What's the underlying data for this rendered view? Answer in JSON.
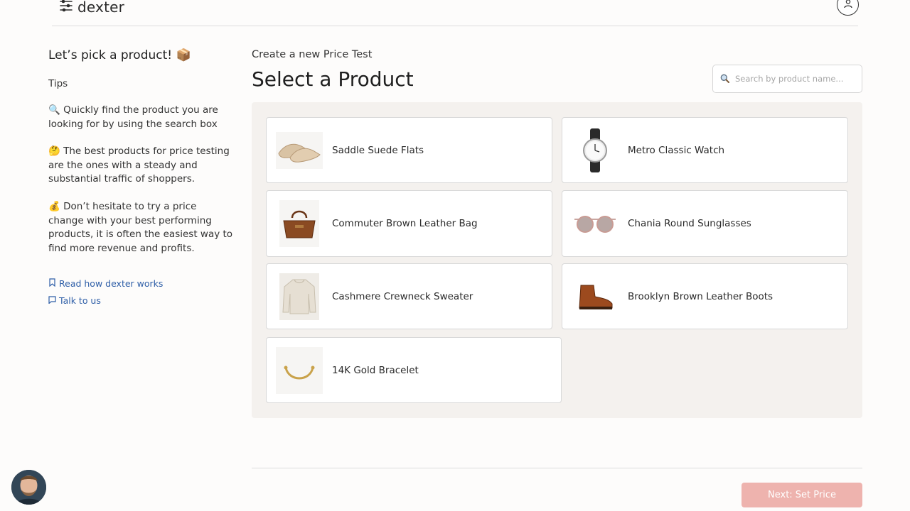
{
  "header": {
    "logo_text": "dexter",
    "logo_icon": "sliders-icon",
    "account_icon": "user-icon"
  },
  "sidebar": {
    "title": "Let’s pick a product! 📦",
    "tips_heading": "Tips",
    "tips": [
      "🔍 Quickly find the product you are looking for by using the search box",
      "🤔 The best products for price testing are the ones with a steady and substantial traffic of shoppers.",
      "💰 Don’t hesitate to try a price change with your best performing products, it is often the easiest way to find more revenue and profits."
    ],
    "links": [
      {
        "label": "Read how dexter works",
        "icon": "bookmark-icon"
      },
      {
        "label": "Talk to us",
        "icon": "chat-bubble-icon"
      }
    ]
  },
  "main": {
    "kicker": "Create a new Price Test",
    "title": "Select a Product",
    "search": {
      "placeholder": "Search by product name...",
      "value": "",
      "icon": "search-icon"
    },
    "products": [
      {
        "name": "Saddle Suede Flats",
        "icon": "shoe-flats-icon"
      },
      {
        "name": "Metro Classic Watch",
        "icon": "watch-icon"
      },
      {
        "name": "Commuter Brown Leather Bag",
        "icon": "bag-icon"
      },
      {
        "name": "Chania Round Sunglasses",
        "icon": "sunglasses-icon"
      },
      {
        "name": "Cashmere Crewneck Sweater",
        "icon": "sweater-icon"
      },
      {
        "name": "Brooklyn Brown Leather Boots",
        "icon": "boot-icon"
      },
      {
        "name": "14K Gold Bracelet",
        "icon": "bracelet-icon"
      }
    ]
  },
  "footer": {
    "next_label": "Next: Set Price",
    "next_color": "#eeb3ae",
    "chat_avatar": "support-avatar"
  }
}
